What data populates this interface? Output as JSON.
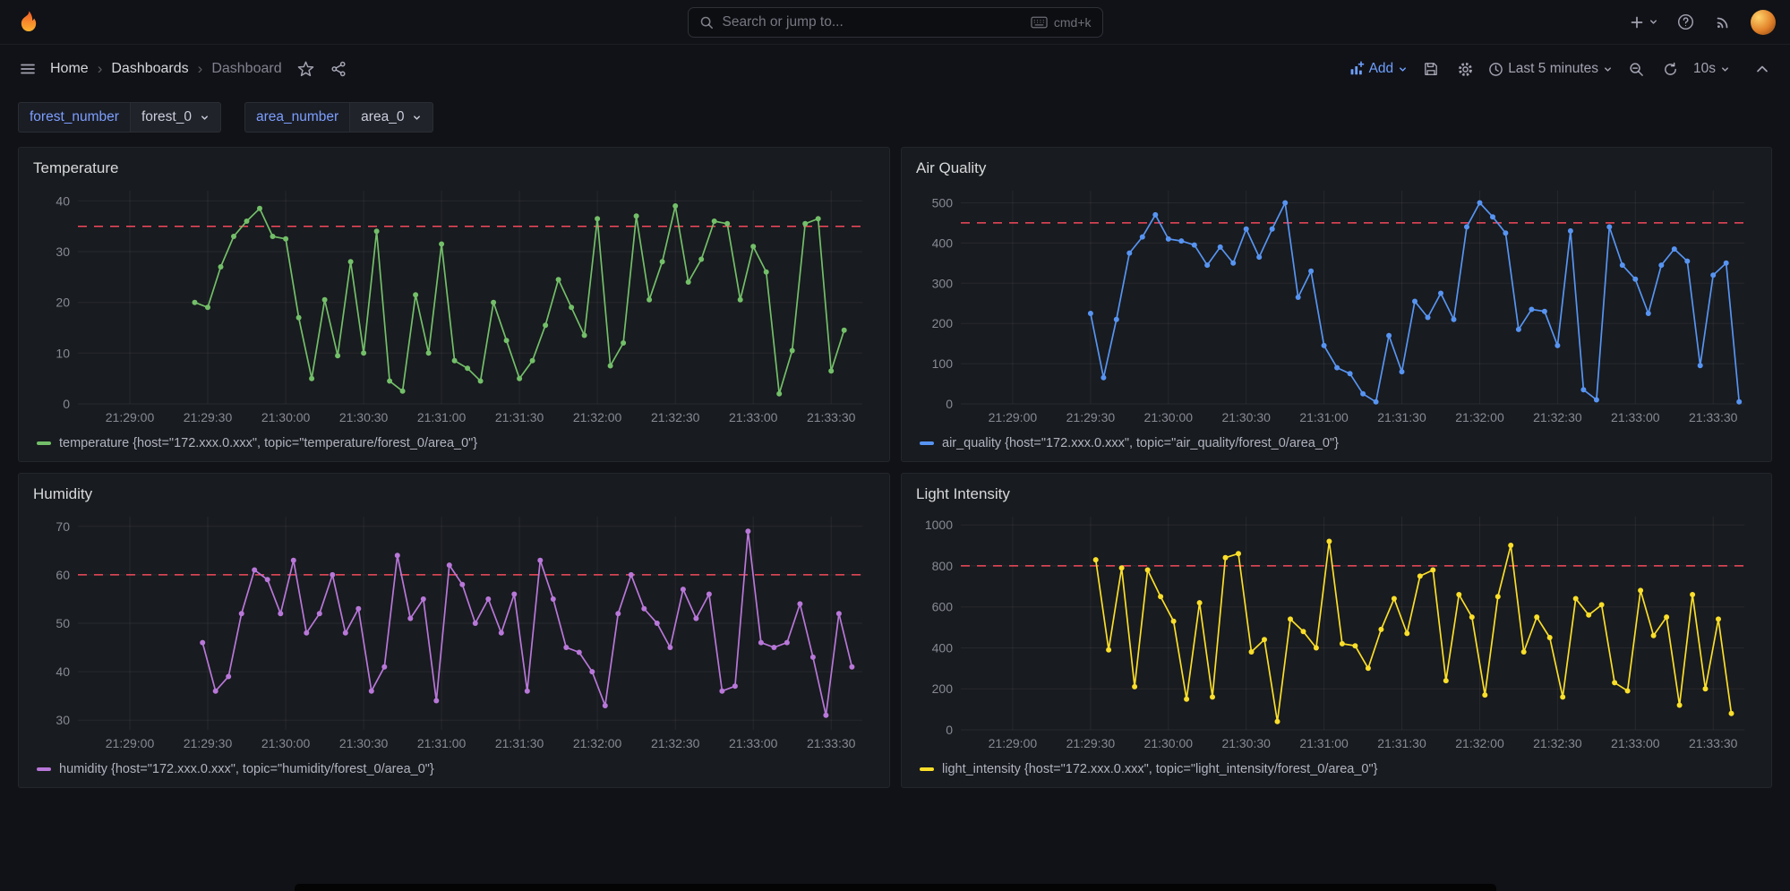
{
  "topnav": {
    "search_placeholder": "Search or jump to...",
    "shortcut_hint": "cmd+k"
  },
  "toolbar": {
    "breadcrumb": [
      "Home",
      "Dashboards",
      "Dashboard"
    ],
    "breadcrumb_separator": "›",
    "add_label": "Add",
    "time_range": "Last 5 minutes",
    "refresh_interval": "10s"
  },
  "variables": [
    {
      "label": "forest_number",
      "value": "forest_0"
    },
    {
      "label": "area_number",
      "value": "area_0"
    }
  ],
  "colors": {
    "accent_blue": "#6e9fff",
    "threshold_red": "#f2495c",
    "panel_bg": "#181b1f",
    "page_bg": "#111217"
  },
  "time_axis": {
    "domain_sec": [
      -20,
      282
    ],
    "tick_secs": [
      0,
      30,
      60,
      90,
      120,
      150,
      180,
      210,
      240,
      270
    ],
    "tick_labels": [
      "21:29:00",
      "21:29:30",
      "21:30:00",
      "21:30:30",
      "21:31:00",
      "21:31:30",
      "21:32:00",
      "21:32:30",
      "21:33:00",
      "21:33:30"
    ]
  },
  "chart_data": [
    {
      "type": "line",
      "title": "Temperature",
      "color": "#73bf69",
      "threshold": 35,
      "ylim": [
        0,
        42
      ],
      "yticks": [
        0,
        10,
        20,
        30,
        40
      ],
      "start_sec": 25,
      "step_sec": 5,
      "values": [
        20,
        19,
        27,
        33,
        36,
        38.5,
        33,
        32.5,
        17,
        5,
        20.5,
        9.5,
        28,
        10,
        34,
        4.5,
        2.5,
        21.5,
        10,
        31.5,
        8.5,
        7,
        4.5,
        20,
        12.5,
        5,
        8.5,
        15.5,
        24.5,
        19,
        13.5,
        36.5,
        7.5,
        12,
        37,
        20.5,
        28,
        39,
        24,
        28.5,
        36,
        35.5,
        20.5,
        31,
        26,
        2,
        10.5,
        35.5,
        36.5,
        6.5,
        14.5
      ],
      "legend": "temperature {host=\"172.xxx.0.xxx\", topic=\"temperature/forest_0/area_0\"}"
    },
    {
      "type": "line",
      "title": "Air Quality",
      "color": "#5794f2",
      "threshold": 450,
      "ylim": [
        0,
        530
      ],
      "yticks": [
        0,
        100,
        200,
        300,
        400,
        500
      ],
      "start_sec": 30,
      "step_sec": 5,
      "values": [
        225,
        65,
        210,
        375,
        415,
        470,
        410,
        405,
        395,
        345,
        390,
        350,
        435,
        365,
        435,
        500,
        265,
        330,
        145,
        90,
        75,
        25,
        5,
        170,
        80,
        255,
        215,
        275,
        210,
        440,
        500,
        465,
        425,
        185,
        235,
        230,
        145,
        430,
        35,
        10,
        440,
        345,
        310,
        225,
        345,
        385,
        355,
        95,
        320,
        350,
        5
      ],
      "legend": "air_quality {host=\"172.xxx.0.xxx\", topic=\"air_quality/forest_0/area_0\"}"
    },
    {
      "type": "line",
      "title": "Humidity",
      "color": "#b877d9",
      "threshold": 60,
      "ylim": [
        28,
        72
      ],
      "yticks": [
        30,
        40,
        50,
        60,
        70
      ],
      "start_sec": 28,
      "step_sec": 5,
      "values": [
        46,
        36,
        39,
        52,
        61,
        59,
        52,
        63,
        48,
        52,
        60,
        48,
        53,
        36,
        41,
        64,
        51,
        55,
        34,
        62,
        58,
        50,
        55,
        48,
        56,
        36,
        63,
        55,
        45,
        44,
        40,
        33,
        52,
        60,
        53,
        50,
        45,
        57,
        51,
        56,
        36,
        37,
        69,
        46,
        45,
        46,
        54,
        43,
        31,
        52,
        41
      ],
      "legend": "humidity {host=\"172.xxx.0.xxx\", topic=\"humidity/forest_0/area_0\"}"
    },
    {
      "type": "line",
      "title": "Light Intensity",
      "color": "#fade2a",
      "threshold": 800,
      "ylim": [
        0,
        1040
      ],
      "yticks": [
        0,
        200,
        400,
        600,
        800,
        1000
      ],
      "start_sec": 32,
      "step_sec": 5,
      "values": [
        830,
        390,
        790,
        210,
        780,
        650,
        530,
        150,
        620,
        160,
        840,
        860,
        380,
        440,
        40,
        540,
        480,
        400,
        920,
        420,
        410,
        300,
        490,
        640,
        470,
        750,
        780,
        240,
        660,
        550,
        170,
        650,
        900,
        380,
        550,
        450,
        160,
        640,
        560,
        610,
        230,
        190,
        680,
        460,
        550,
        120,
        660,
        200,
        540,
        80
      ],
      "legend": "light_intensity {host=\"172.xxx.0.xxx\", topic=\"light_intensity/forest_0/area_0\"}"
    }
  ]
}
